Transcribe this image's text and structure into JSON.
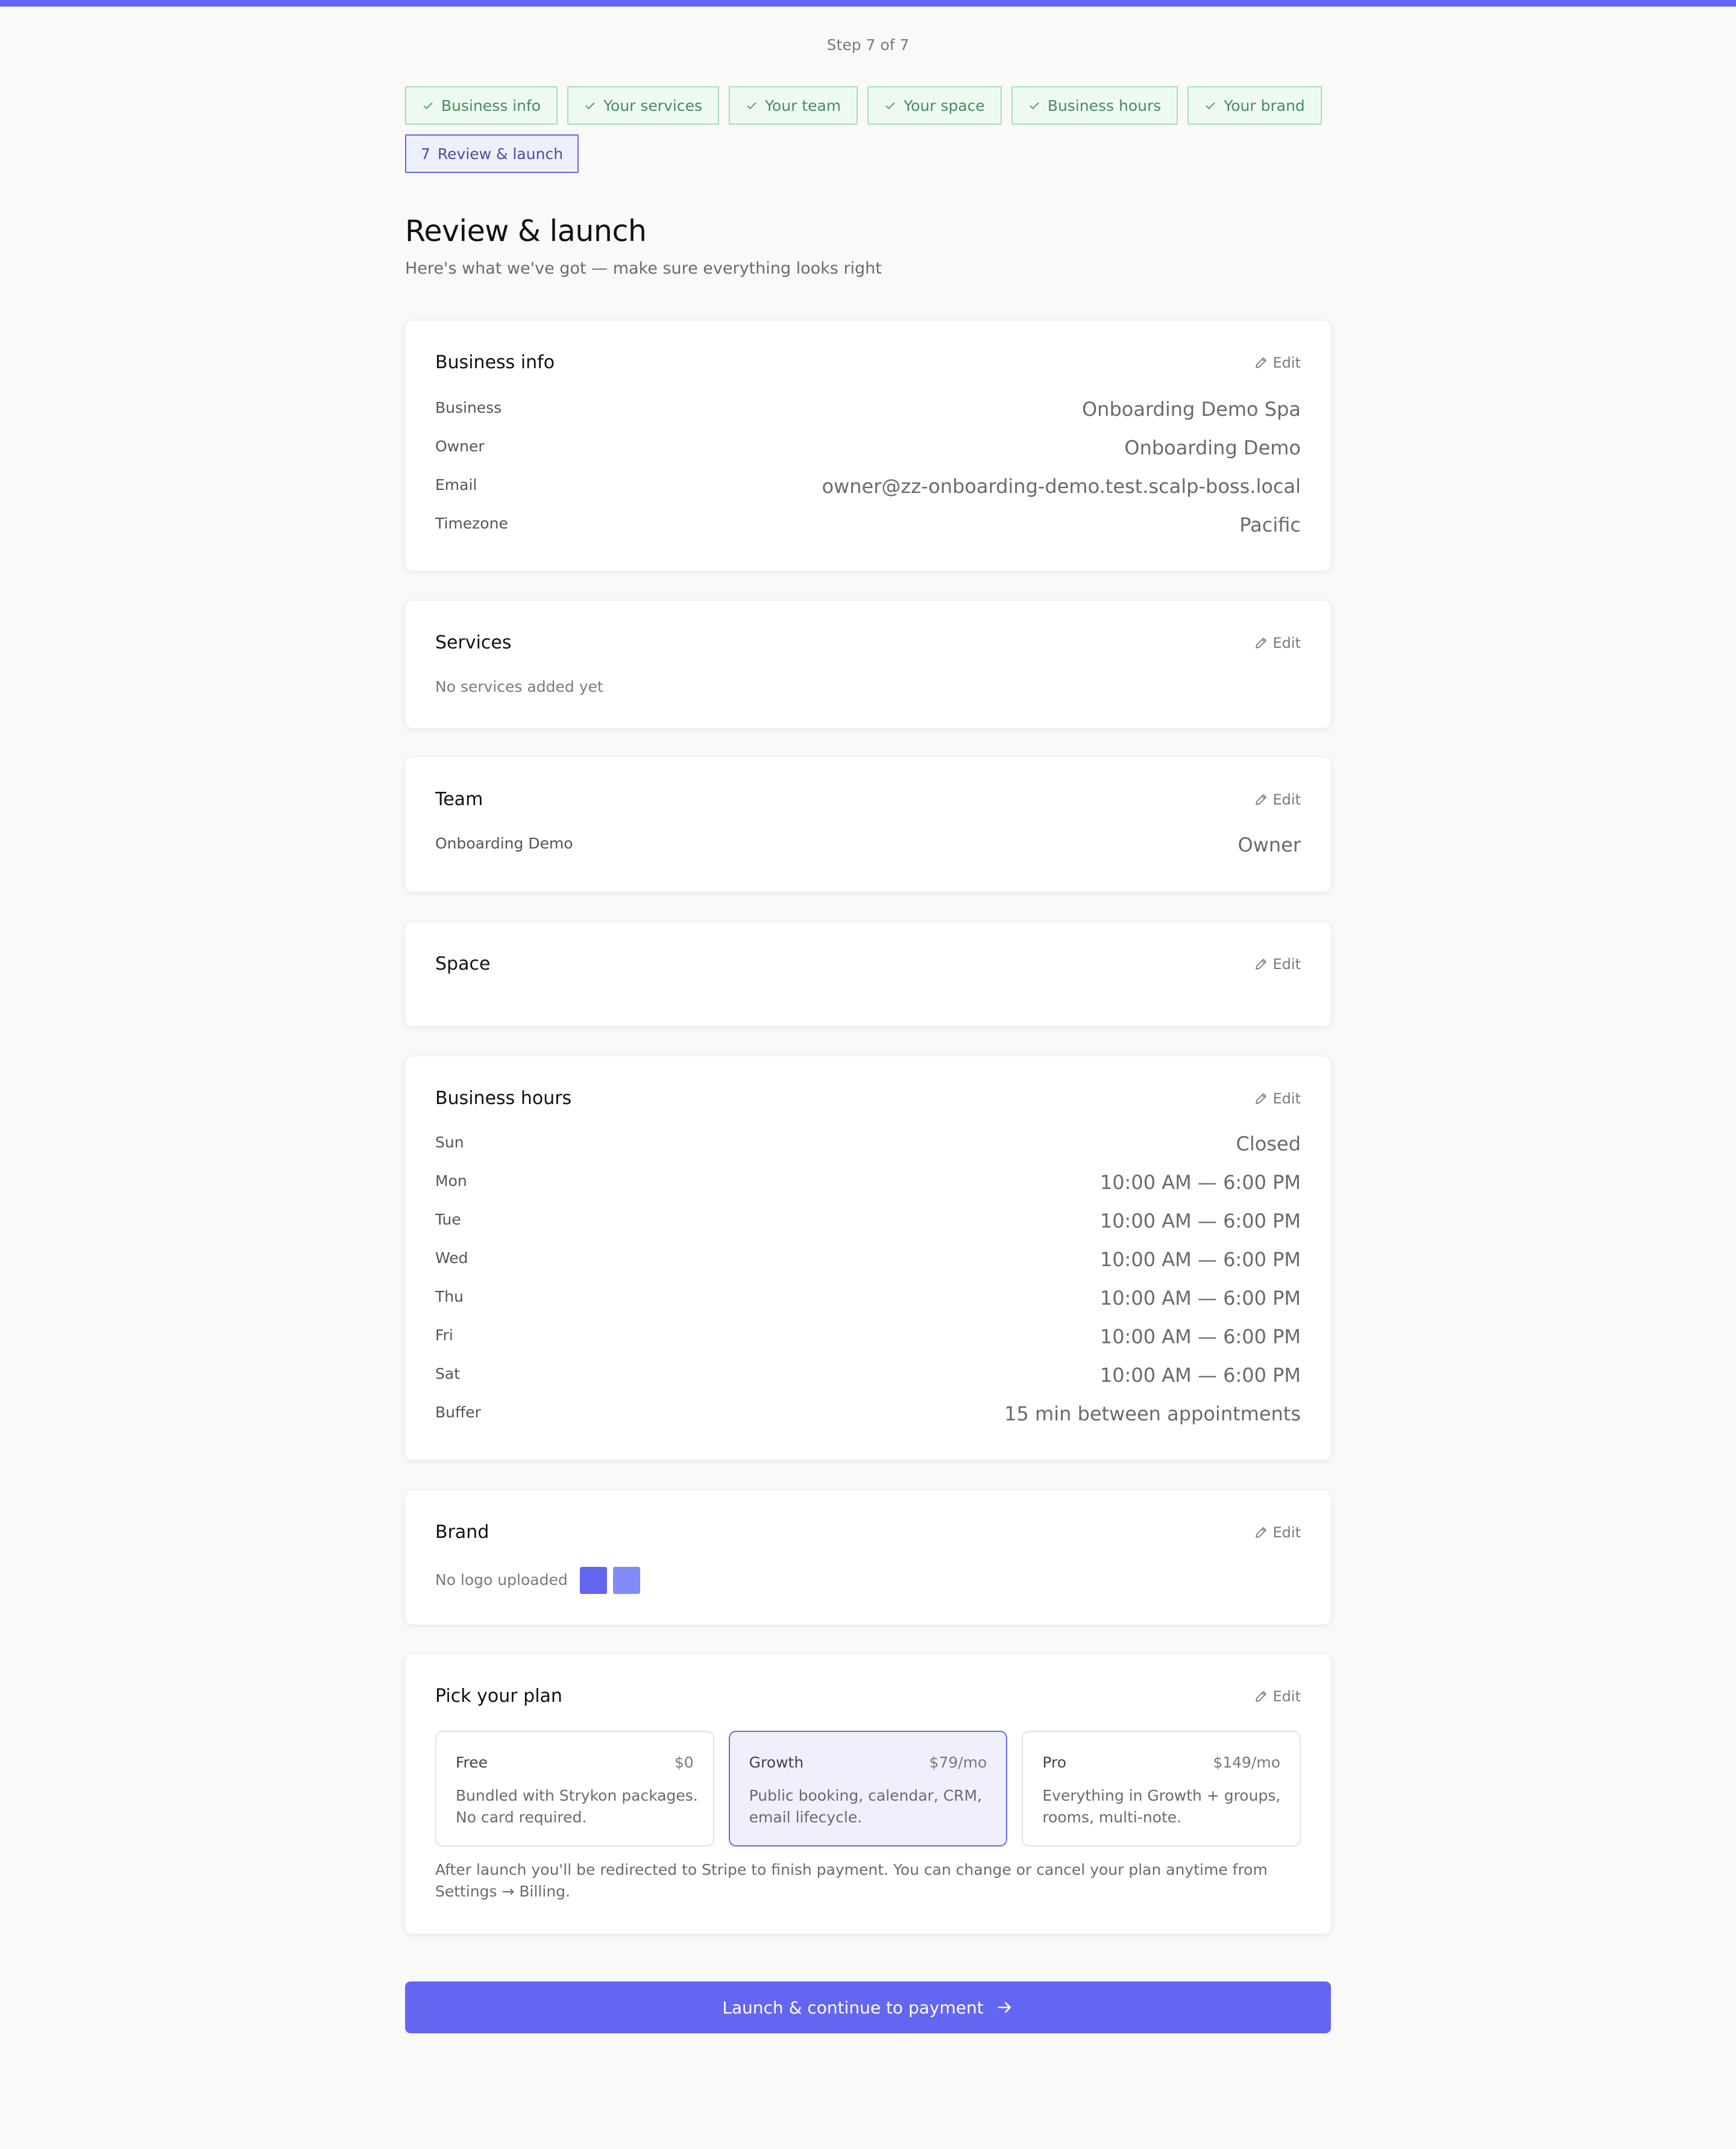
{
  "progress": {
    "step_label": "Step 7 of 7"
  },
  "stepper": {
    "steps": [
      {
        "label": "Business info",
        "status": "complete"
      },
      {
        "label": "Your services",
        "status": "complete"
      },
      {
        "label": "Your team",
        "status": "complete"
      },
      {
        "label": "Your space",
        "status": "complete"
      },
      {
        "label": "Business hours",
        "status": "complete"
      },
      {
        "label": "Your brand",
        "status": "complete"
      },
      {
        "label": "Review & launch",
        "status": "current",
        "number": "7"
      }
    ]
  },
  "page": {
    "title": "Review & launch",
    "subtitle": "Here's what we've got — make sure everything looks right"
  },
  "edit_label": "Edit",
  "business_info": {
    "title": "Business info",
    "rows": [
      {
        "label": "Business",
        "value": "Onboarding Demo Spa"
      },
      {
        "label": "Owner",
        "value": "Onboarding Demo"
      },
      {
        "label": "Email",
        "value": "owner@zz-onboarding-demo.test.scalp-boss.local"
      },
      {
        "label": "Timezone",
        "value": "Pacific"
      }
    ]
  },
  "services": {
    "title": "Services",
    "empty_text": "No services added yet"
  },
  "team": {
    "title": "Team",
    "members": [
      {
        "name": "Onboarding Demo",
        "role": "Owner"
      }
    ]
  },
  "space": {
    "title": "Space"
  },
  "business_hours": {
    "title": "Business hours",
    "rows": [
      {
        "label": "Sun",
        "value": "Closed"
      },
      {
        "label": "Mon",
        "value": "10:00 AM — 6:00 PM"
      },
      {
        "label": "Tue",
        "value": "10:00 AM — 6:00 PM"
      },
      {
        "label": "Wed",
        "value": "10:00 AM — 6:00 PM"
      },
      {
        "label": "Thu",
        "value": "10:00 AM — 6:00 PM"
      },
      {
        "label": "Fri",
        "value": "10:00 AM — 6:00 PM"
      },
      {
        "label": "Sat",
        "value": "10:00 AM — 6:00 PM"
      },
      {
        "label": "Buffer",
        "value": "15 min between appointments"
      }
    ]
  },
  "brand": {
    "title": "Brand",
    "logo_text": "No logo uploaded",
    "colors": {
      "primary": "#6366f1",
      "secondary": "#818cf8"
    }
  },
  "plan": {
    "title": "Pick your plan",
    "options": [
      {
        "name": "Free",
        "price": "$0",
        "description": "Bundled with Strykon packages. No card required.",
        "selected": false
      },
      {
        "name": "Growth",
        "price": "$79/mo",
        "description": "Public booking, calendar, CRM, email lifecycle.",
        "selected": true
      },
      {
        "name": "Pro",
        "price": "$149/mo",
        "description": "Everything in Growth + groups, rooms, multi-note.",
        "selected": false
      }
    ],
    "note": "After launch you'll be redirected to Stripe to finish payment. You can change or cancel your plan anytime from Settings → Billing."
  },
  "launch_button": {
    "label": "Launch & continue to payment"
  },
  "theme": {
    "accent": "#6366f1",
    "success_bg": "#eefaf1",
    "success_border": "#a6dfba"
  }
}
